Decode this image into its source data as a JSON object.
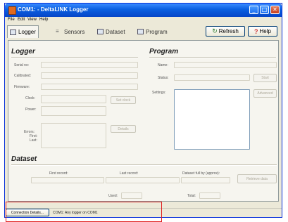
{
  "window": {
    "title": "COM1: - DeltaLINK Logger"
  },
  "menu": [
    "File",
    "Edit",
    "View",
    "Help"
  ],
  "tabs": [
    {
      "label": "Logger",
      "icon": "logger-icon",
      "active": true
    },
    {
      "label": "Sensors",
      "icon": "sensors-icon",
      "active": false
    },
    {
      "label": "Dataset",
      "icon": "dataset-icon",
      "active": false
    },
    {
      "label": "Program",
      "icon": "program-icon",
      "active": false
    }
  ],
  "toolbar": {
    "refresh_label": "Refresh",
    "help_label": "Help"
  },
  "logger": {
    "title": "Logger",
    "serial_label": "Serial no:",
    "calibrated_label": "Calibrated:",
    "firmware_label": "Firmware:",
    "clock_label": "Clock:",
    "power_label": "Power:",
    "errors_label": "Errors:",
    "first_label": "First:",
    "last_label": "Last:",
    "clock_button": "Set clock",
    "errors_button": "Details"
  },
  "program": {
    "title": "Program",
    "name_label": "Name:",
    "status_label": "Status:",
    "settings_label": "Settings:",
    "status_button": "Start",
    "settings_button": "Advanced"
  },
  "dataset": {
    "title": "Dataset",
    "first_record_label": "First record:",
    "last_record_label": "Last record:",
    "full_by_label": "Dataset full by (approx):",
    "used_label": "Used:",
    "total_label": "Total:",
    "action_button": "Retrieve data"
  },
  "status": {
    "button_label": "Connection Details...",
    "text": "COM1: Any logger on COM1"
  }
}
